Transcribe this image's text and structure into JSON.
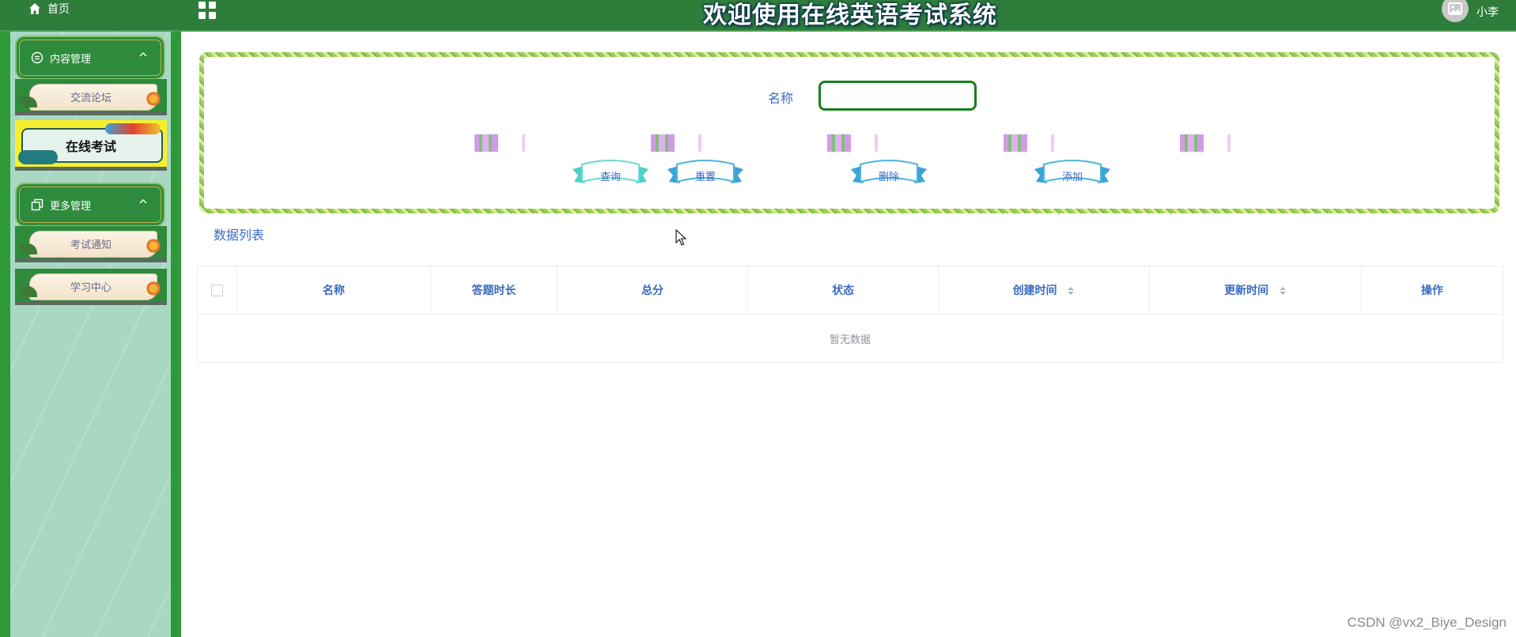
{
  "header": {
    "home_label": "首页",
    "title": "欢迎使用在线英语考试系统",
    "user_name": "小李"
  },
  "sidebar": {
    "groups": [
      {
        "label": "内容管理",
        "items": [
          {
            "label": "交流论坛"
          },
          {
            "label": "在线考试",
            "active": true
          }
        ]
      },
      {
        "label": "更多管理",
        "items": [
          {
            "label": "考试通知"
          },
          {
            "label": "学习中心"
          }
        ]
      }
    ]
  },
  "search": {
    "name_label": "名称",
    "name_value": "",
    "buttons": {
      "query": "查询",
      "reset": "重置",
      "delete": "删除",
      "add": "添加"
    }
  },
  "list": {
    "title": "数据列表",
    "columns": [
      "名称",
      "答题时长",
      "总分",
      "状态",
      "创建时间",
      "更新时间",
      "操作"
    ],
    "sortable_columns": [
      "创建时间",
      "更新时间"
    ],
    "rows": [],
    "empty_text": "暂无数据"
  },
  "watermark": "CSDN @vx2_Biye_Design",
  "colors": {
    "header_bg": "#2e7d3a",
    "sidebar_bg": "#a8d8c4",
    "accent_text": "#3a6ac0",
    "input_border": "#17811c",
    "active_menu": "#f6f02c"
  }
}
